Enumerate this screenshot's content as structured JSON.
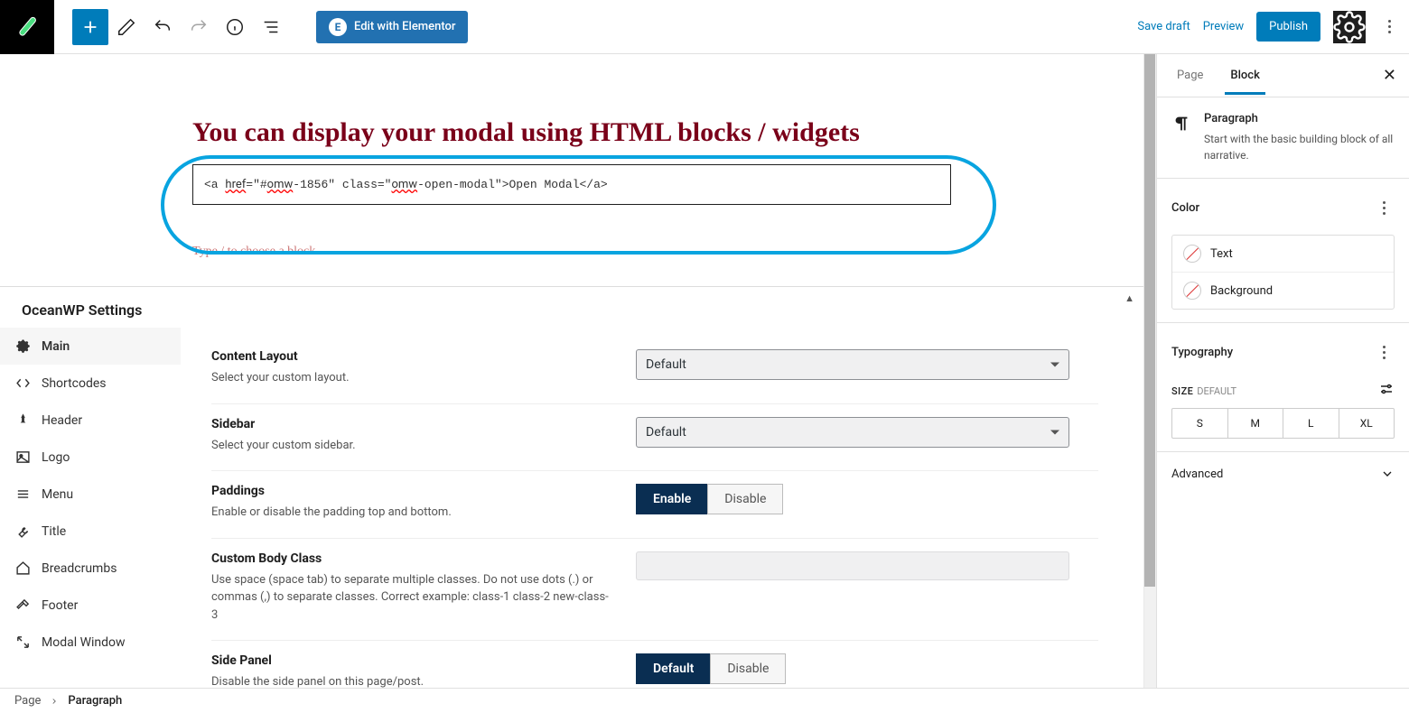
{
  "topbar": {
    "save_draft": "Save draft",
    "preview": "Preview",
    "publish": "Publish",
    "elementor": "Edit with Elementor"
  },
  "canvas": {
    "title": "You can display your modal using HTML blocks / widgets",
    "code_text": "<a href=\"#omw-1856\" class=\"omw-open-modal\">Open Modal</a>",
    "placeholder": "Type / to choose a block"
  },
  "owp": {
    "title": "OceanWP Settings",
    "nav": [
      {
        "label": "Main",
        "icon": "gear"
      },
      {
        "label": "Shortcodes",
        "icon": "code"
      },
      {
        "label": "Header",
        "icon": "pin"
      },
      {
        "label": "Logo",
        "icon": "image"
      },
      {
        "label": "Menu",
        "icon": "menu"
      },
      {
        "label": "Title",
        "icon": "wrench"
      },
      {
        "label": "Breadcrumbs",
        "icon": "home"
      },
      {
        "label": "Footer",
        "icon": "footer"
      },
      {
        "label": "Modal Window",
        "icon": "expand"
      }
    ],
    "fields": {
      "content_layout": {
        "label": "Content Layout",
        "desc": "Select your custom layout.",
        "value": "Default"
      },
      "sidebar": {
        "label": "Sidebar",
        "desc": "Select your custom sidebar.",
        "value": "Default"
      },
      "paddings": {
        "label": "Paddings",
        "desc": "Enable or disable the padding top and bottom.",
        "enable": "Enable",
        "disable": "Disable"
      },
      "body_class": {
        "label": "Custom Body Class",
        "desc": "Use space (space tab) to separate multiple classes. Do not use dots (.) or commas (,) to separate classes. Correct example: class-1 class-2 new-class-3"
      },
      "side_panel": {
        "label": "Side Panel",
        "desc": "Disable the side panel on this page/post.",
        "enable": "Default",
        "disable": "Disable"
      }
    }
  },
  "sidebar": {
    "tabs": {
      "page": "Page",
      "block": "Block"
    },
    "block": {
      "name": "Paragraph",
      "desc": "Start with the basic building block of all narrative."
    },
    "color": {
      "title": "Color",
      "text": "Text",
      "background": "Background"
    },
    "typo": {
      "title": "Typography",
      "size": "SIZE",
      "default": "DEFAULT",
      "options": [
        "S",
        "M",
        "L",
        "XL"
      ]
    },
    "advanced": "Advanced"
  },
  "breadcrumb": {
    "root": "Page",
    "current": "Paragraph"
  }
}
